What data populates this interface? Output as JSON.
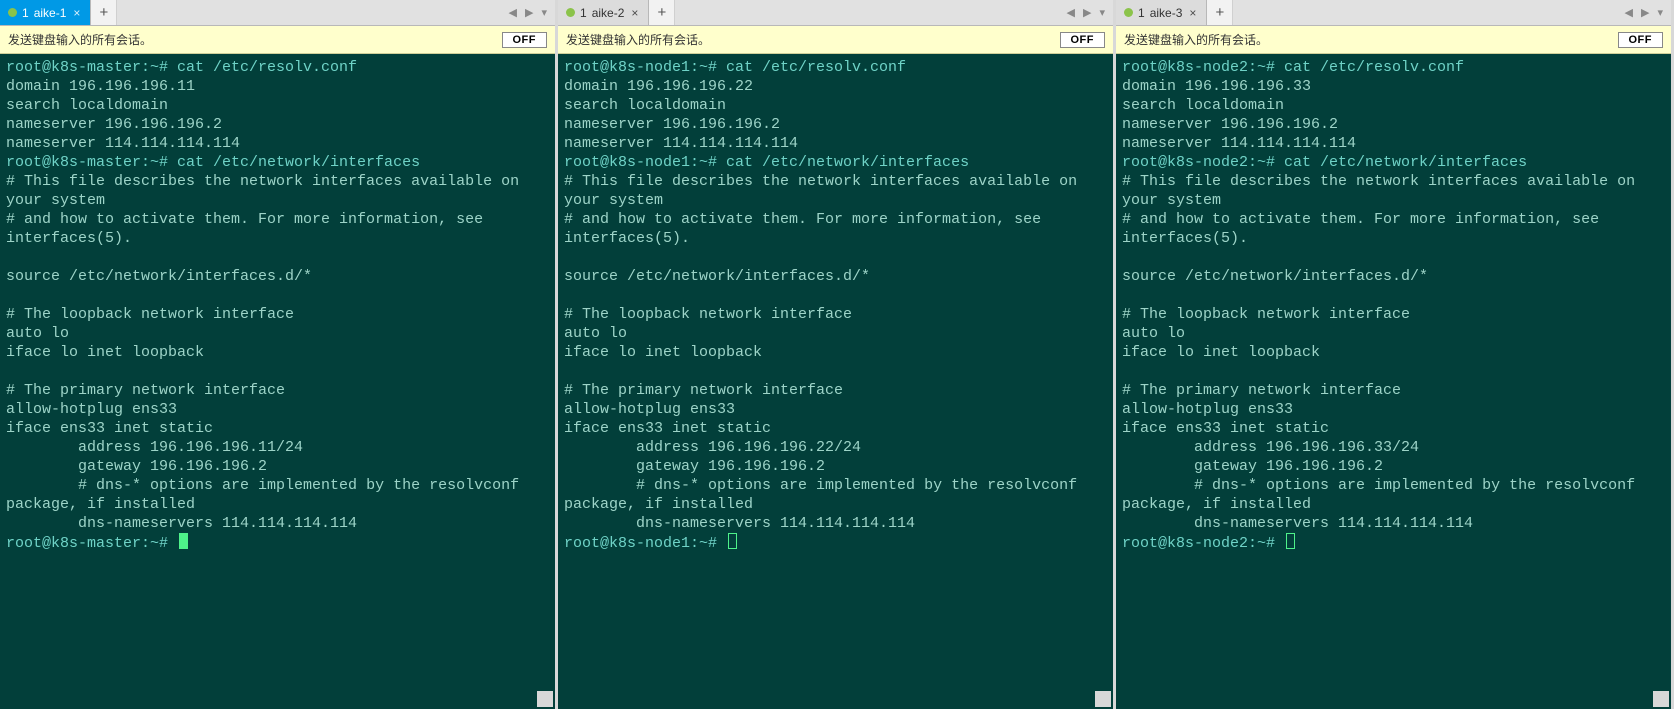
{
  "panes": [
    {
      "tab": {
        "index": "1",
        "label": "aike-1",
        "active": true
      },
      "notice": "发送键盘输入的所有会话。",
      "off_label": "OFF",
      "hostname": "k8s-master",
      "prompt1": "root@k8s-master:~# cat /etc/resolv.conf",
      "resolv": [
        "domain 196.196.196.11",
        "search localdomain",
        "nameserver 196.196.196.2",
        "nameserver 114.114.114.114"
      ],
      "prompt2": "root@k8s-master:~# cat /etc/network/interfaces",
      "interfaces": [
        "# This file describes the network interfaces available on your system",
        "# and how to activate them. For more information, see interfaces(5).",
        "",
        "source /etc/network/interfaces.d/*",
        "",
        "# The loopback network interface",
        "auto lo",
        "iface lo inet loopback",
        "",
        "# The primary network interface",
        "allow-hotplug ens33",
        "iface ens33 inet static",
        "        address 196.196.196.11/24",
        "        gateway 196.196.196.2",
        "        # dns-* options are implemented by the resolvconf package, if installed",
        "        dns-nameservers 114.114.114.114"
      ],
      "prompt3": "root@k8s-master:~# ",
      "cursor": "solid"
    },
    {
      "tab": {
        "index": "1",
        "label": "aike-2",
        "active": false
      },
      "notice": "发送键盘输入的所有会话。",
      "off_label": "OFF",
      "hostname": "k8s-node1",
      "prompt1": "root@k8s-node1:~# cat /etc/resolv.conf",
      "resolv": [
        "domain 196.196.196.22",
        "search localdomain",
        "nameserver 196.196.196.2",
        "nameserver 114.114.114.114"
      ],
      "prompt2": "root@k8s-node1:~# cat /etc/network/interfaces",
      "interfaces": [
        "# This file describes the network interfaces available on your system",
        "# and how to activate them. For more information, see interfaces(5).",
        "",
        "source /etc/network/interfaces.d/*",
        "",
        "# The loopback network interface",
        "auto lo",
        "iface lo inet loopback",
        "",
        "# The primary network interface",
        "allow-hotplug ens33",
        "iface ens33 inet static",
        "        address 196.196.196.22/24",
        "        gateway 196.196.196.2",
        "        # dns-* options are implemented by the resolvconf package, if installed",
        "        dns-nameservers 114.114.114.114"
      ],
      "prompt3": "root@k8s-node1:~# ",
      "cursor": "hollow"
    },
    {
      "tab": {
        "index": "1",
        "label": "aike-3",
        "active": false
      },
      "notice": "发送键盘输入的所有会话。",
      "off_label": "OFF",
      "hostname": "k8s-node2",
      "prompt1": "root@k8s-node2:~# cat /etc/resolv.conf",
      "resolv": [
        "domain 196.196.196.33",
        "search localdomain",
        "nameserver 196.196.196.2",
        "nameserver 114.114.114.114"
      ],
      "prompt2": "root@k8s-node2:~# cat /etc/network/interfaces",
      "interfaces": [
        "# This file describes the network interfaces available on your system",
        "# and how to activate them. For more information, see interfaces(5).",
        "",
        "source /etc/network/interfaces.d/*",
        "",
        "# The loopback network interface",
        "auto lo",
        "iface lo inet loopback",
        "",
        "# The primary network interface",
        "allow-hotplug ens33",
        "iface ens33 inet static",
        "        address 196.196.196.33/24",
        "        gateway 196.196.196.2",
        "        # dns-* options are implemented by the resolvconf package, if installed",
        "        dns-nameservers 114.114.114.114"
      ],
      "prompt3": "root@k8s-node2:~# ",
      "cursor": "hollow"
    }
  ],
  "tabbar_icons": {
    "prev": "◀",
    "next": "▶",
    "menu": "▾",
    "add": "+",
    "close": "×"
  }
}
